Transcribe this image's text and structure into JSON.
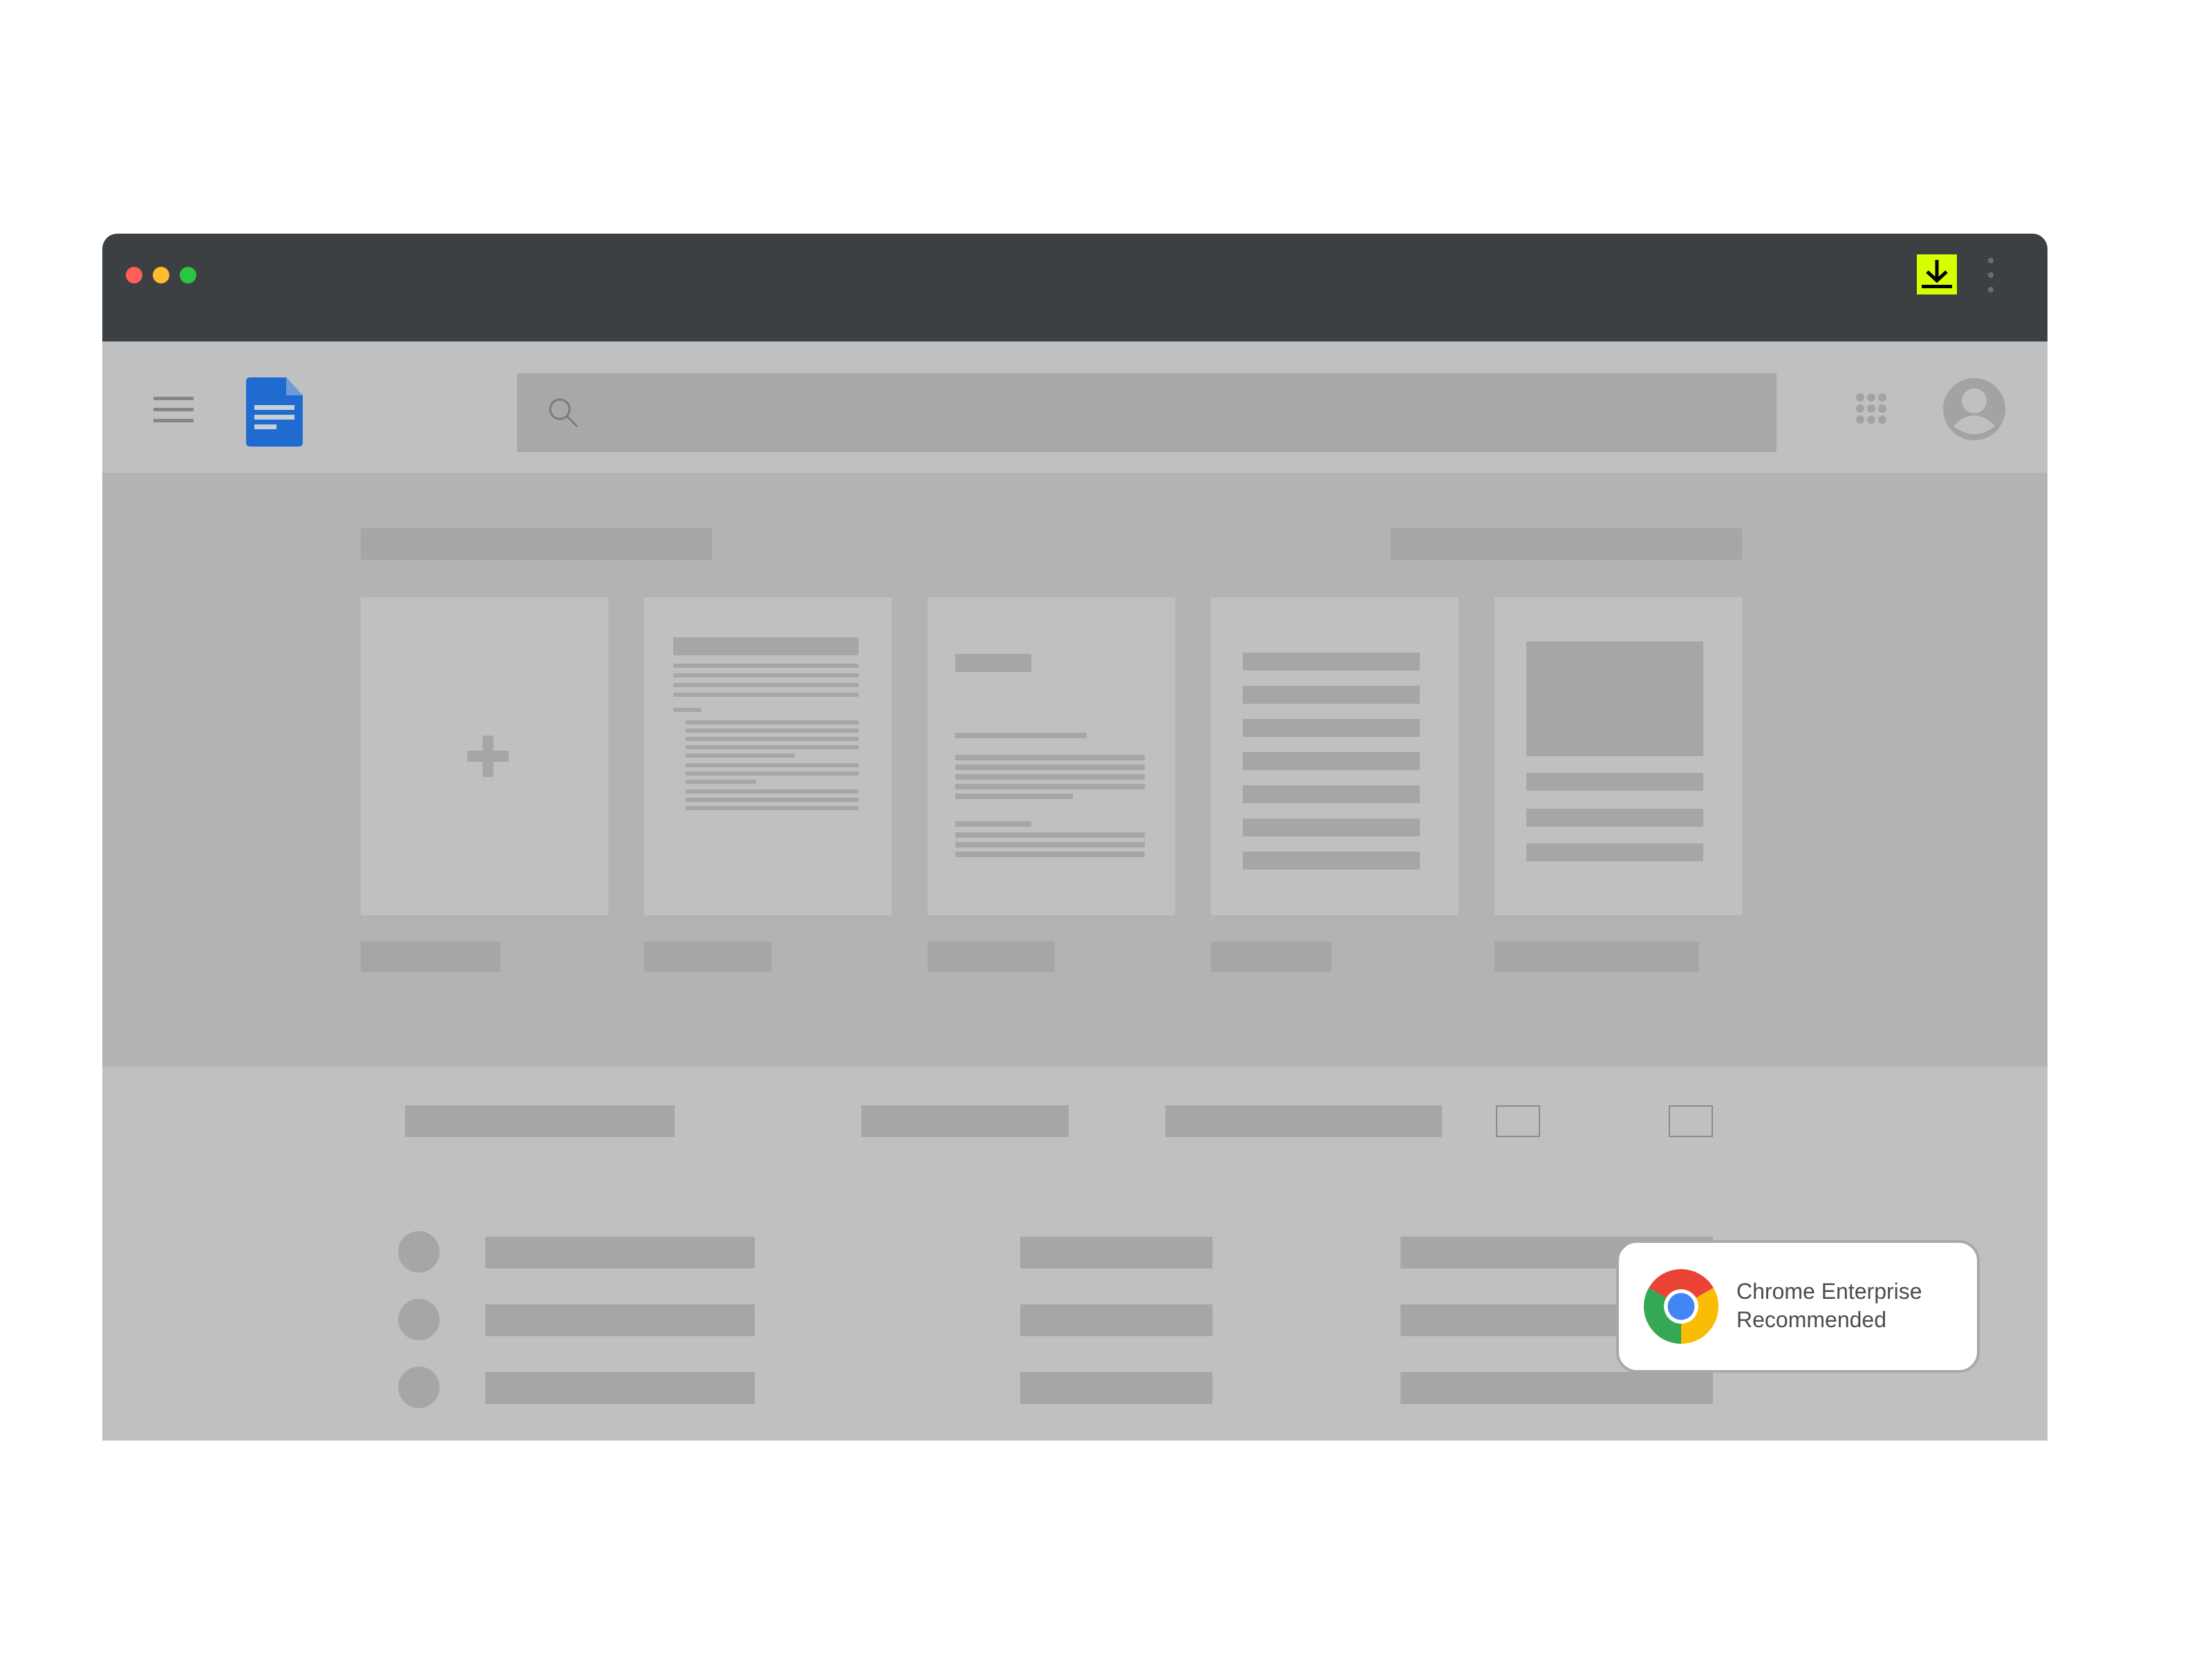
{
  "window": {
    "controls": [
      {
        "name": "close",
        "color": "#ff5f57"
      },
      {
        "name": "minimize",
        "color": "#febc2e"
      },
      {
        "name": "maximize",
        "color": "#28c840"
      }
    ],
    "download_button": {
      "icon": "download-icon",
      "color": "#d6ff00"
    },
    "menu_button": {
      "icon": "kebab-menu-icon"
    }
  },
  "toolbar": {
    "menu_icon": "hamburger-icon",
    "app_logo": {
      "icon": "google-docs-icon",
      "color": "#1f6bd0"
    },
    "search": {
      "icon": "search-icon",
      "placeholder": ""
    },
    "apps_icon": "apps-grid-icon",
    "account_icon": "account-avatar-icon"
  },
  "templates": {
    "cards": [
      {
        "kind": "blank",
        "icon": "plus-icon"
      },
      {
        "kind": "document"
      },
      {
        "kind": "letter"
      },
      {
        "kind": "list"
      },
      {
        "kind": "image-page"
      }
    ]
  },
  "badge": {
    "icon": "chrome-logo-icon",
    "line1": "Chrome Enterprise",
    "line2": "Recommended",
    "colors": {
      "red": "#ea4335",
      "yellow": "#fbbc04",
      "green": "#34a853",
      "blue": "#4285f4"
    }
  }
}
